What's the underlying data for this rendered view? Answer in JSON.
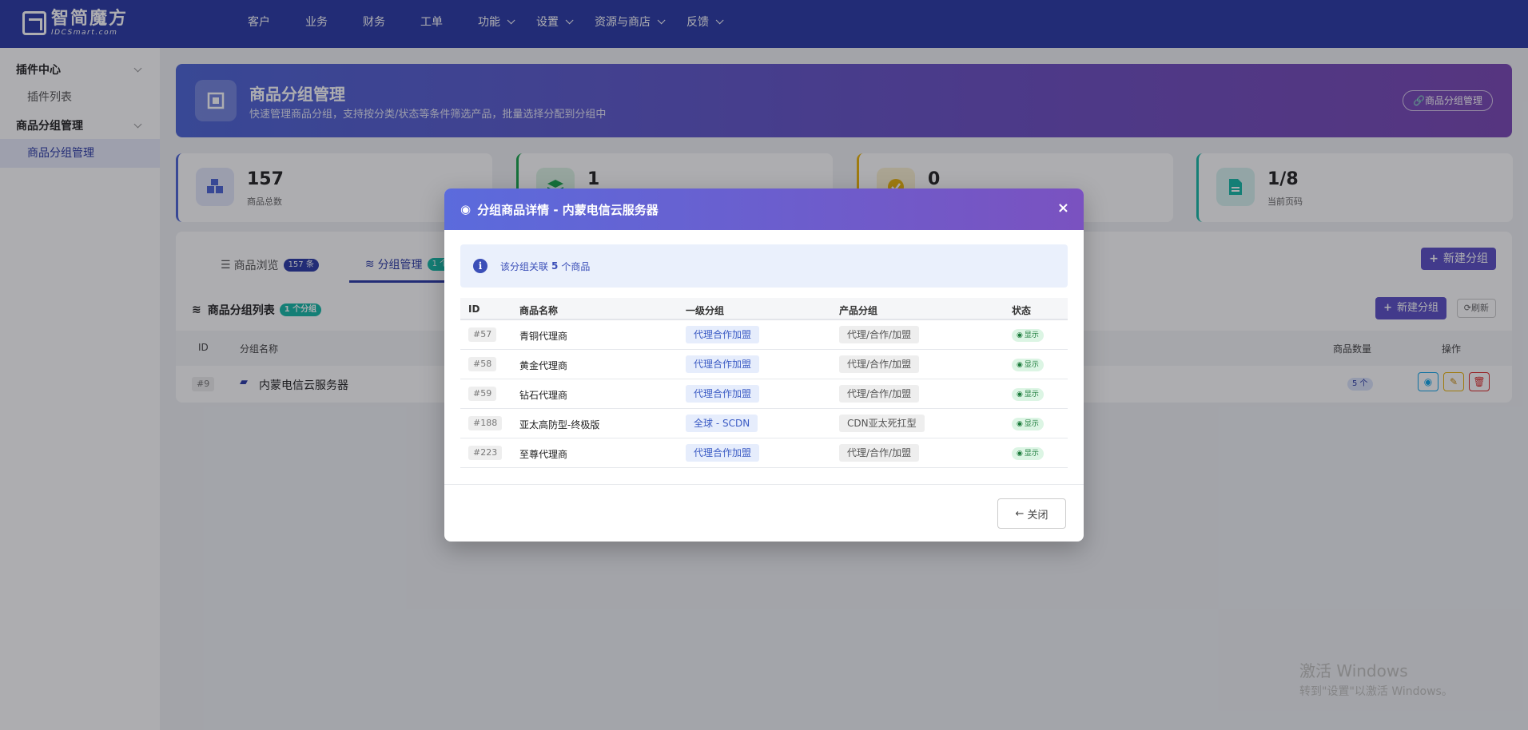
{
  "logo": {
    "cn": "智简魔方",
    "en": "IDCSmart.com"
  },
  "nav": [
    {
      "label": "客户",
      "dropdown": false
    },
    {
      "label": "业务",
      "dropdown": false
    },
    {
      "label": "财务",
      "dropdown": false
    },
    {
      "label": "工单",
      "dropdown": false
    },
    {
      "label": "功能",
      "dropdown": true
    },
    {
      "label": "设置",
      "dropdown": true
    },
    {
      "label": "资源与商店",
      "dropdown": true
    },
    {
      "label": "反馈",
      "dropdown": true
    }
  ],
  "sidebar": {
    "groups": [
      {
        "label": "插件中心",
        "items": [
          {
            "label": "插件列表",
            "active": false
          }
        ]
      },
      {
        "label": "商品分组管理",
        "items": [
          {
            "label": "商品分组管理",
            "active": true
          }
        ]
      }
    ]
  },
  "header": {
    "title": "商品分组管理",
    "subtitle": "快速管理商品分组，支持按分类/状态等条件筛选产品，批量选择分配到分组中",
    "button": "商品分组管理"
  },
  "stats": [
    {
      "value": "157",
      "label": "商品总数",
      "color": "#4c64d6"
    },
    {
      "value": "1",
      "label": "",
      "color": "#16a34a"
    },
    {
      "value": "0",
      "label": "",
      "color": "#eab308"
    },
    {
      "value": "1/8",
      "label": "当前页码",
      "color": "#14b8a6"
    }
  ],
  "panel": {
    "tab_browse": "商品浏览",
    "tab_browse_count": "157 条",
    "tab_groups": "分组管理",
    "tab_groups_count": "1 个",
    "new_group_top": "新建分组",
    "list_title": "商品分组列表",
    "list_count": "1 个分组",
    "new_group": "新建分组",
    "refresh": "刷新",
    "columns": {
      "id": "ID",
      "name": "分组名称",
      "count": "商品数量",
      "ops": "操作"
    },
    "row": {
      "id": "#9",
      "name": "内蒙电信云服务器",
      "count": "5 个"
    }
  },
  "modal": {
    "title": "分组商品详情 - 内蒙电信云服务器",
    "info_prefix": "该分组关联",
    "info_count": "5",
    "info_suffix": "个商品",
    "columns": {
      "id": "ID",
      "name": "商品名称",
      "cat1": "一级分组",
      "cat2": "产品分组",
      "status": "状态"
    },
    "rows": [
      {
        "id": "#57",
        "name": "青铜代理商",
        "cat1": "代理合作加盟",
        "cat2": "代理/合作/加盟",
        "status": "显示"
      },
      {
        "id": "#58",
        "name": "黄金代理商",
        "cat1": "代理合作加盟",
        "cat2": "代理/合作/加盟",
        "status": "显示"
      },
      {
        "id": "#59",
        "name": "钻石代理商",
        "cat1": "代理合作加盟",
        "cat2": "代理/合作/加盟",
        "status": "显示"
      },
      {
        "id": "#188",
        "name": "亚太高防型-终极版",
        "cat1": "全球 - SCDN",
        "cat2": "CDN亚太死扛型",
        "status": "显示"
      },
      {
        "id": "#223",
        "name": "至尊代理商",
        "cat1": "代理合作加盟",
        "cat2": "代理/合作/加盟",
        "status": "显示"
      }
    ],
    "close_label": "关闭"
  },
  "watermark": {
    "line1": "激活 Windows",
    "line2": "转到\"设置\"以激活 Windows。"
  }
}
